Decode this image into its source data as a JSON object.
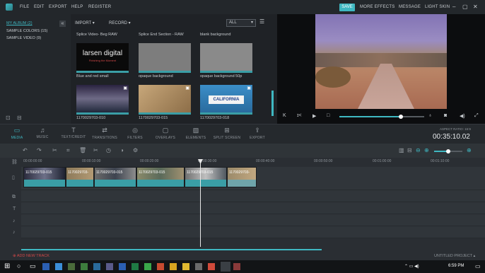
{
  "menu": {
    "file": "FILE",
    "edit": "EDIT",
    "export": "EXPORT",
    "help": "HELP",
    "register": "REGISTER",
    "save": "SAVE",
    "more_effects": "MORE EFFECTS",
    "message": "MESSAGE",
    "light_skin": "LIGHT SKIN"
  },
  "sidebar": {
    "items": [
      {
        "label": "MY ALBUM (2)"
      },
      {
        "label": "SAMPLE COLORS (15)"
      },
      {
        "label": "SAMPLE VIDEO (9)"
      }
    ]
  },
  "media": {
    "import_label": "IMPORT",
    "record_label": "RECORD",
    "filter_value": "ALL",
    "items": [
      {
        "title": "Splice Video- Beg RAW",
        "caption": "Blue and red small",
        "thumb_text": "larsen digital",
        "thumb_sub": "Finishing the Moment"
      },
      {
        "title": "Splice End Section - RAW",
        "caption": "opaque background"
      },
      {
        "title": "blank background",
        "caption": "opaque background 50p"
      },
      {
        "caption": "1170029703-010"
      },
      {
        "caption": "1170029703-015"
      },
      {
        "caption": "1170029703-018",
        "thumb_text": "CALIFORNIA"
      }
    ]
  },
  "toolbar": {
    "tools": [
      {
        "label": "MEDIA"
      },
      {
        "label": "MUSIC"
      },
      {
        "label": "TEXT/CREDIT"
      },
      {
        "label": "TRANSITIONS"
      },
      {
        "label": "FILTERS"
      },
      {
        "label": "OVERLAYS"
      },
      {
        "label": "ELEMENTS"
      },
      {
        "label": "SPLIT SCREEN"
      },
      {
        "label": "EXPORT"
      }
    ],
    "aspect_ratio": "ASPECT RATIO: 16:9",
    "timecode": "00:35:10.02"
  },
  "timeline": {
    "ruler": [
      "00:00:00:00",
      "00:00:10:00",
      "00:00:20:00",
      "00:00:30:00",
      "00:00:40:00",
      "00:00:50:00",
      "00:01:00:00",
      "00:01:10:00"
    ],
    "clips": [
      {
        "label": "1170029703-015"
      },
      {
        "label": "1170029703-"
      },
      {
        "label": "1170029703-015"
      },
      {
        "label": "1170029703-015"
      },
      {
        "label": "1170029703-015"
      },
      {
        "label": "1170029703-"
      }
    ],
    "add_track": "ADD NEW TRACK",
    "project_name": "UNTITLED PROJECT"
  },
  "taskbar": {
    "time": "6:59 PM",
    "date": "..."
  },
  "colors": {
    "accent": "#3fb8c2",
    "clip_bar": "#3a9ea6",
    "preview_sky": "#7b6ea8"
  }
}
